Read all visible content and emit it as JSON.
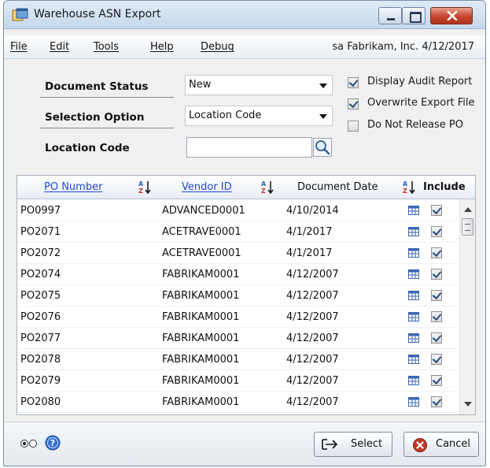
{
  "window": {
    "title": "Warehouse ASN Export"
  },
  "menu": {
    "items": [
      "File",
      "Edit",
      "Tools",
      "Help",
      "Debug"
    ],
    "user_info": "sa  Fabrikam, Inc.  4/12/2017"
  },
  "form": {
    "document_status_label": "Document Status",
    "document_status_value": "New",
    "selection_option_label": "Selection Option",
    "selection_option_value": "Location Code",
    "location_code_label": "Location Code",
    "location_code_value": ""
  },
  "options": [
    {
      "label": "Display Audit Report",
      "checked": true
    },
    {
      "label": "Overwrite Export File",
      "checked": true
    },
    {
      "label": "Do Not Release PO",
      "checked": false
    }
  ],
  "grid": {
    "columns": [
      "PO Number",
      "Vendor ID",
      "Document Date",
      "Include"
    ],
    "rows": [
      {
        "po": "PO0997",
        "vendor": "ADVANCED0001",
        "date": "4/10/2014",
        "include": true
      },
      {
        "po": "PO2071",
        "vendor": "ACETRAVE0001",
        "date": "4/1/2017",
        "include": true
      },
      {
        "po": "PO2072",
        "vendor": "ACETRAVE0001",
        "date": "4/1/2017",
        "include": true
      },
      {
        "po": "PO2074",
        "vendor": "FABRIKAM0001",
        "date": "4/12/2007",
        "include": true
      },
      {
        "po": "PO2075",
        "vendor": "FABRIKAM0001",
        "date": "4/12/2007",
        "include": true
      },
      {
        "po": "PO2076",
        "vendor": "FABRIKAM0001",
        "date": "4/12/2007",
        "include": true
      },
      {
        "po": "PO2077",
        "vendor": "FABRIKAM0001",
        "date": "4/12/2007",
        "include": true
      },
      {
        "po": "PO2078",
        "vendor": "FABRIKAM0001",
        "date": "4/12/2007",
        "include": true
      },
      {
        "po": "PO2079",
        "vendor": "FABRIKAM0001",
        "date": "4/12/2007",
        "include": true
      },
      {
        "po": "PO2080",
        "vendor": "FABRIKAM0001",
        "date": "4/12/2007",
        "include": true
      }
    ]
  },
  "footer": {
    "select_label": "Select",
    "cancel_label": "Cancel"
  },
  "icons": {
    "app": "app-window-icon",
    "lookup": "lookup-magnifier-icon",
    "sort": "sort-az-icon",
    "row_detail": "grid-detail-icon",
    "help": "help-icon",
    "select": "select-arrow-icon",
    "cancel": "cancel-x-icon"
  },
  "colors": {
    "link": "#1f4ad8",
    "cancel_red": "#c0392b",
    "help_blue": "#2f6fd6"
  }
}
